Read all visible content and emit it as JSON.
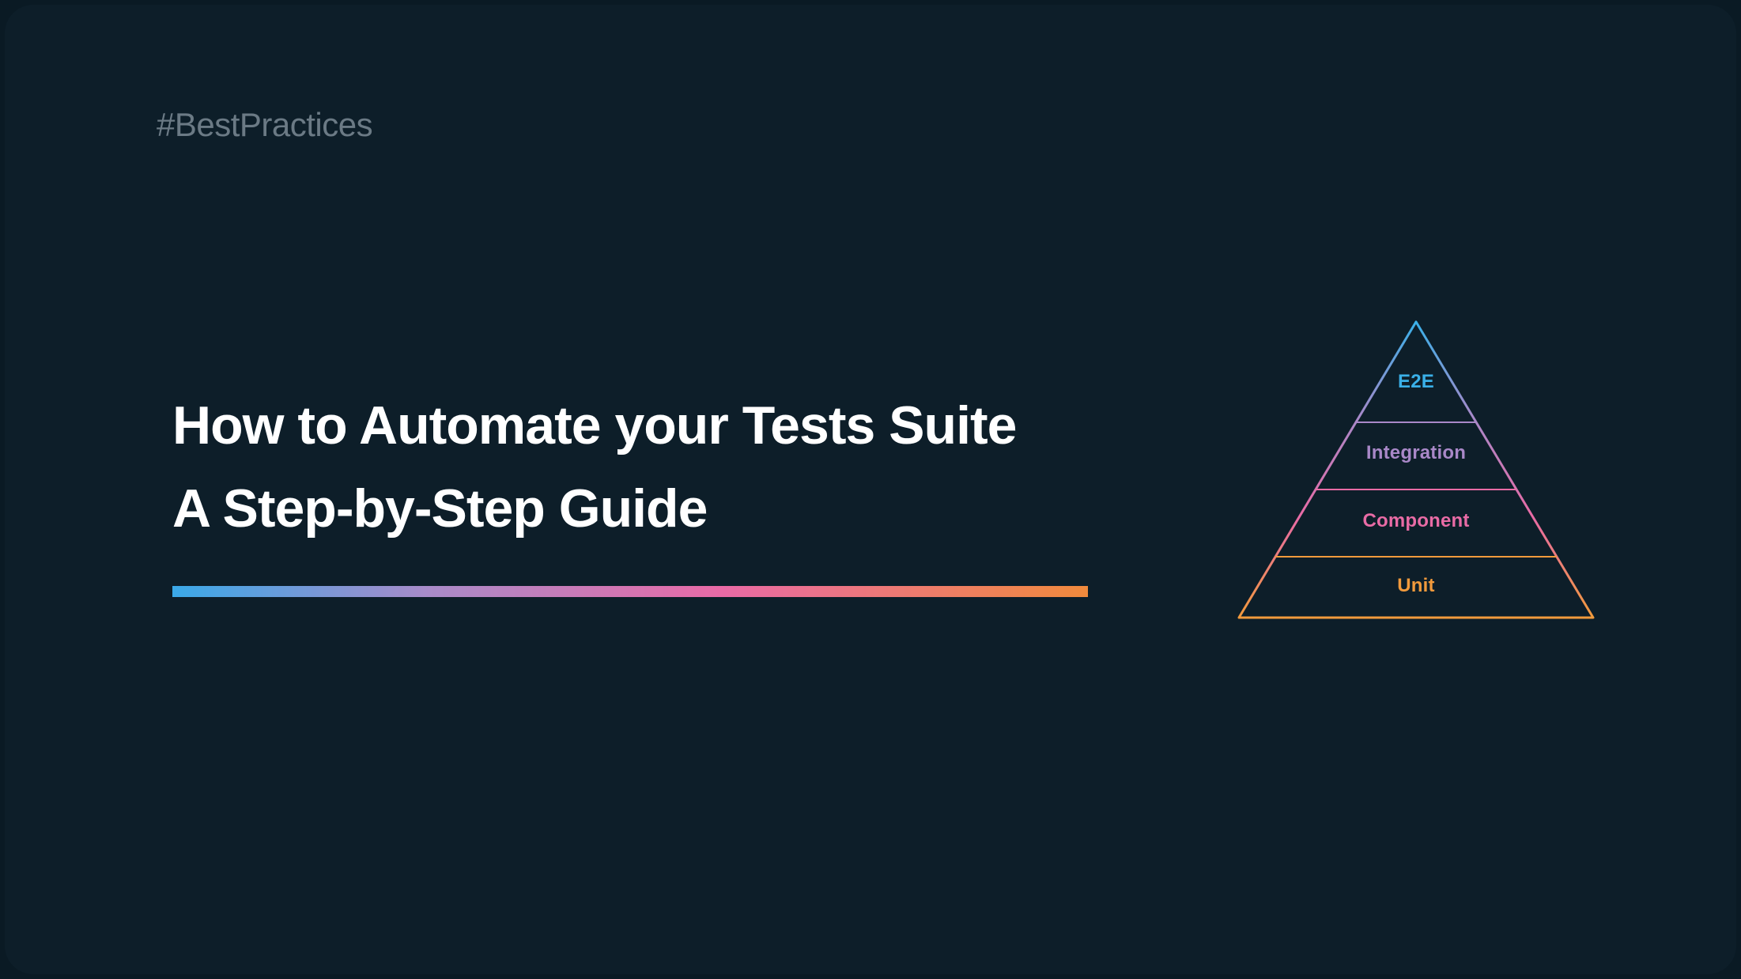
{
  "tag": "#BestPractices",
  "title": {
    "line1": "How to Automate your Tests Suite",
    "line2": "A Step-by-Step Guide"
  },
  "pyramid": {
    "levels": [
      {
        "label": "E2E",
        "color": "#3ab0e8"
      },
      {
        "label": "Integration",
        "color": "#a988c8"
      },
      {
        "label": "Component",
        "color": "#e86ba5"
      },
      {
        "label": "Unit",
        "color": "#f19a3c"
      }
    ]
  },
  "colors": {
    "gradient": [
      "#3aa9e8",
      "#a98bc9",
      "#e96aa6",
      "#f08a3c"
    ],
    "background": "#0d1e29"
  }
}
